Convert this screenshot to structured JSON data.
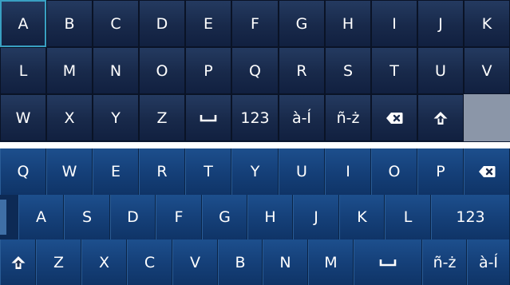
{
  "grid_keyboard": {
    "selected_key": "A",
    "rows": [
      [
        "A",
        "B",
        "C",
        "D",
        "E",
        "F",
        "G",
        "H",
        "I",
        "J",
        "K"
      ],
      [
        "L",
        "M",
        "N",
        "O",
        "P",
        "Q",
        "R",
        "S",
        "T",
        "U",
        "V"
      ],
      [
        "W",
        "X",
        "Y",
        "Z",
        "␣",
        "123",
        "à-Í",
        "ñ-ż",
        "⌫",
        "⇧",
        ""
      ]
    ]
  },
  "qwerty_keyboard": {
    "rows": [
      [
        "Q",
        "W",
        "E",
        "R",
        "T",
        "Y",
        "U",
        "I",
        "O",
        "P",
        "⌫"
      ],
      [
        "A",
        "S",
        "D",
        "F",
        "G",
        "H",
        "J",
        "K",
        "L",
        "123"
      ],
      [
        "⇧",
        "Z",
        "X",
        "C",
        "V",
        "B",
        "N",
        "M",
        "␣",
        "ñ-ż",
        "à-Í"
      ]
    ]
  }
}
